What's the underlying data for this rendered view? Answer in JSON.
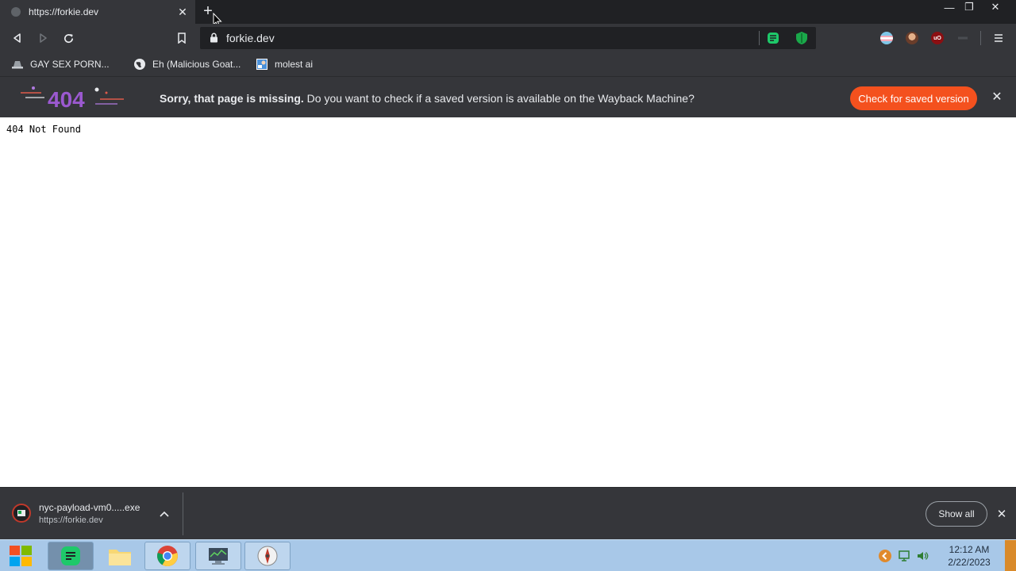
{
  "browser": {
    "tab": {
      "title": "https://forkie.dev",
      "close_glyph": "✕"
    },
    "newtab_glyph": "+",
    "window_controls": {
      "minimize": "—",
      "restore": "❐",
      "close": "✕"
    },
    "omnibox": {
      "url": "forkie.dev"
    }
  },
  "bookmarks": [
    {
      "label": "GAY SEX PORN...",
      "icon": "hat-icon"
    },
    {
      "label": "Eh (Malicious Goat...",
      "icon": "globe-icon"
    },
    {
      "label": "molest ai",
      "icon": "image-icon"
    }
  ],
  "wayback": {
    "logo_text": "404",
    "message_bold": "Sorry, that page is missing.",
    "message_rest": " Do you want to check if a saved version is available on the Wayback Machine?",
    "button_label": "Check for saved version",
    "close_glyph": "✕"
  },
  "page": {
    "body_text": "404 Not Found"
  },
  "download": {
    "filename": "nyc-payload-vm0.....exe",
    "source": "https://forkie.dev",
    "chevron": "︿",
    "show_all_label": "Show all",
    "close_glyph": "✕"
  },
  "taskbar": {
    "clock_time": "12:12 AM",
    "clock_date": "2/22/2023"
  },
  "colors": {
    "chrome_dark": "#202124",
    "chrome_mid": "#35363a",
    "wayback_button": "#f4511e",
    "taskbar": "#a8c8e8"
  }
}
